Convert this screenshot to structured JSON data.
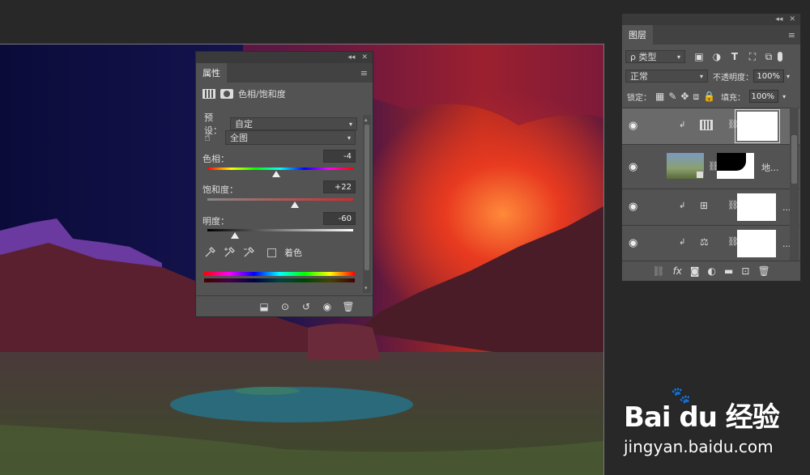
{
  "properties_panel": {
    "tab_label": "属性",
    "adjustment_name": "色相/饱和度",
    "preset_label": "预设：",
    "preset_value": "自定",
    "channel_value": "全图",
    "hue_label": "色相：",
    "hue_value": "-4",
    "saturation_label": "饱和度：",
    "saturation_value": "+22",
    "lightness_label": "明度：",
    "lightness_value": "-60",
    "colorize_label": "着色"
  },
  "layers_panel": {
    "tab_label": "图层",
    "filter_kind": "ρ 类型",
    "blend_mode": "正常",
    "opacity_label": "不透明度：",
    "opacity_value": "100%",
    "lock_label": "锁定：",
    "fill_label": "填充：",
    "fill_value": "100%",
    "layer_2_name": "地..."
  },
  "watermark": {
    "brand": "Bai du 经验",
    "url": "jingyan.baidu.com"
  }
}
